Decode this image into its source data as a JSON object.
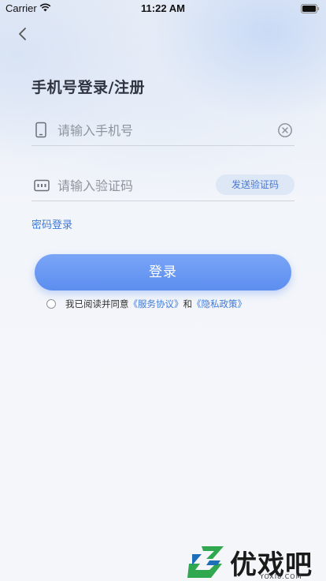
{
  "status_bar": {
    "carrier": "Carrier",
    "time": "11:22 AM"
  },
  "page": {
    "title": "手机号登录/注册"
  },
  "phone_field": {
    "placeholder": "请输入手机号",
    "value": ""
  },
  "code_field": {
    "placeholder": "请输入验证码",
    "value": "",
    "send_code_label": "发送验证码"
  },
  "password_login_label": "密码登录",
  "login_button_label": "登录",
  "agreement": {
    "prefix": "我已阅读并同意",
    "service_link": "《服务协议》",
    "connector": "和",
    "privacy_link": "《隐私政策》",
    "checked": false
  },
  "watermark": {
    "text": "优戏吧",
    "url": "YOXI8.COM"
  },
  "colors": {
    "accent": "#5c8ef0",
    "link": "#3f7ad8",
    "send_code_bg": "#dde7f6"
  },
  "icons": [
    "wifi-icon",
    "battery-icon",
    "back-chevron-icon",
    "phone-icon",
    "code-keyboard-icon",
    "clear-icon"
  ]
}
